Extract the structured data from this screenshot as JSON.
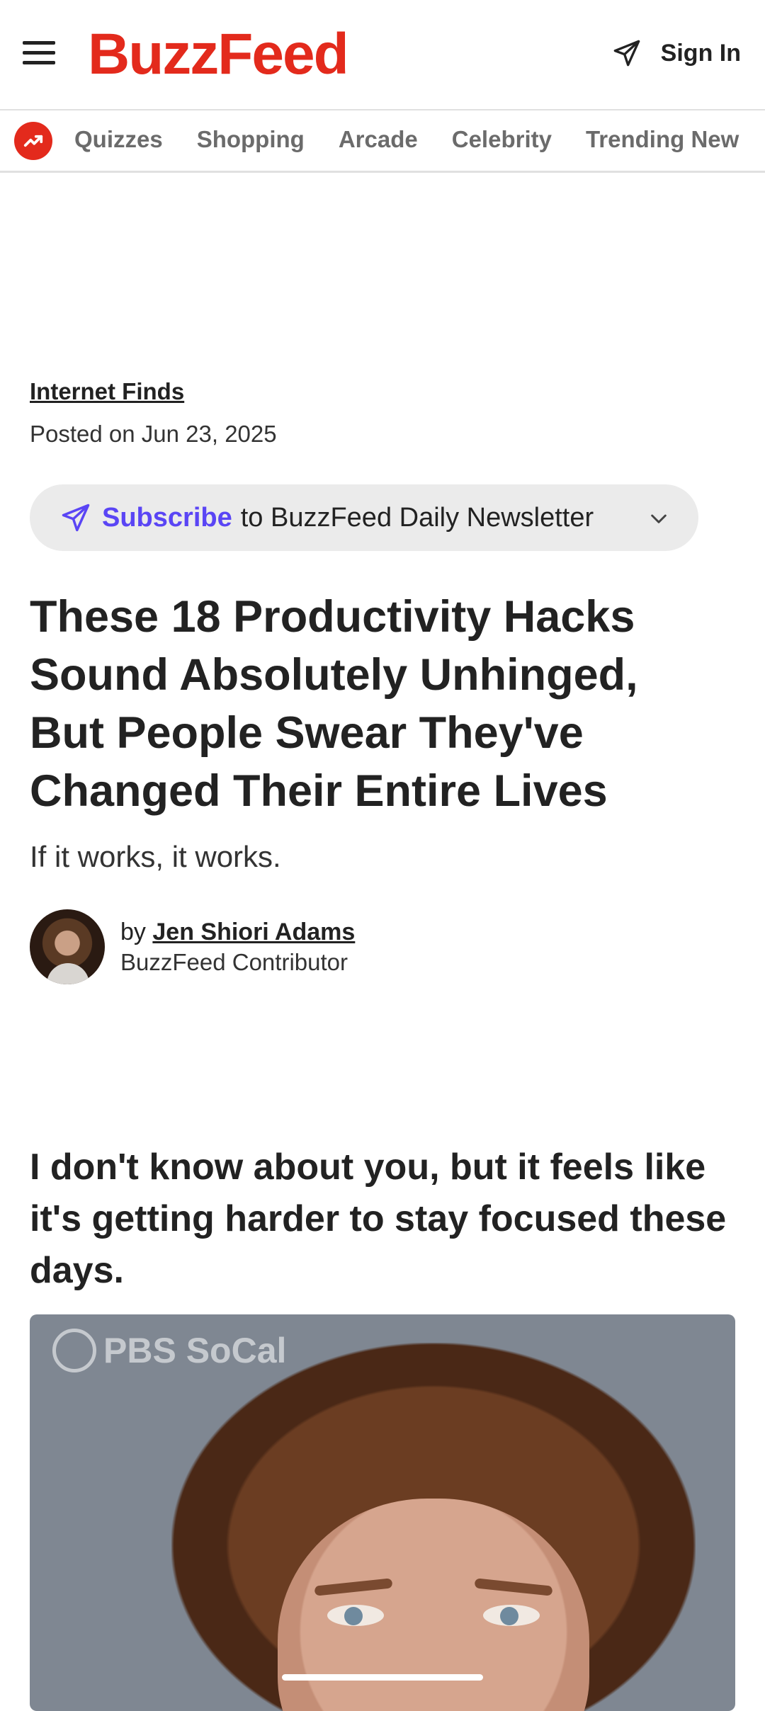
{
  "header": {
    "logo": "BuzzFeed",
    "sign_in_label": "Sign In"
  },
  "nav": {
    "items": [
      {
        "label": "Quizzes"
      },
      {
        "label": "Shopping"
      },
      {
        "label": "Arcade"
      },
      {
        "label": "Celebrity"
      },
      {
        "label": "Trending New"
      }
    ]
  },
  "article": {
    "category": "Internet Finds",
    "posted": "Posted on Jun 23, 2025",
    "subscribe": {
      "link": "Subscribe",
      "text": "to BuzzFeed Daily Newsletter"
    },
    "headline": "These 18 Productivity Hacks Sound Absolutely Unhinged, But People Swear They've Changed Their Entire Lives",
    "dek": "If it works, it works.",
    "byline": {
      "prefix": "by",
      "author": "Jen Shiori Adams",
      "role": "BuzzFeed Contributor"
    },
    "intro": "I don't know about you, but it feels like it's getting harder to stay focused these days.",
    "media": {
      "watermark": "PBS SoCal"
    }
  },
  "colors": {
    "brand": "#e32a1c",
    "subscribe_link": "#5a45f5"
  }
}
